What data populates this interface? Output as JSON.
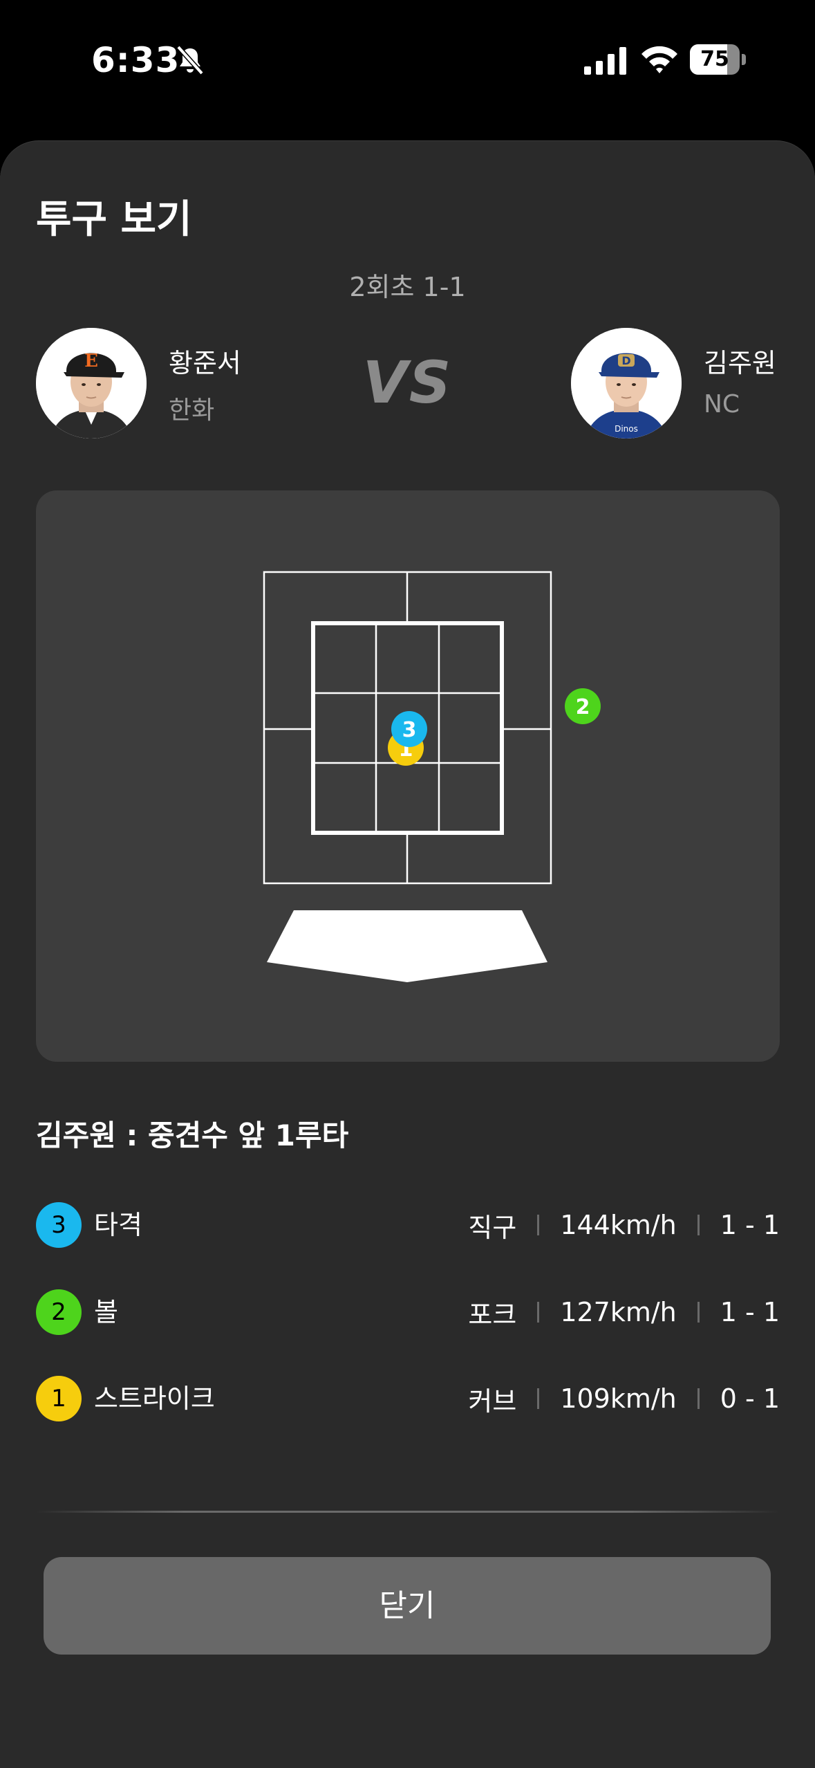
{
  "status_bar": {
    "time": "6:33",
    "battery_percent": "75",
    "battery_level": 0.75,
    "icons": [
      "bell-slash-icon",
      "cellular-signal-icon",
      "wifi-icon",
      "battery-icon"
    ]
  },
  "sheet": {
    "title": "투구 보기",
    "inning": "2회초 1-1",
    "vs_label": "VS",
    "pitcher": {
      "name": "황준서",
      "team": "한화"
    },
    "batter": {
      "name": "김주원",
      "team": "NC"
    },
    "result_text": "김주원 : 중견수 앞 1루타",
    "close_label": "닫기"
  },
  "pitches": [
    {
      "number": "3",
      "result": "타격",
      "type": "직구",
      "speed": "144km/h",
      "count": "1 - 1",
      "color": "#1ab8ee"
    },
    {
      "number": "2",
      "result": "볼",
      "type": "포크",
      "speed": "127km/h",
      "count": "1 - 1",
      "color": "#4ed41c"
    },
    {
      "number": "1",
      "result": "스트라이크",
      "type": "커브",
      "speed": "109km/h",
      "count": "0 - 1",
      "color": "#f6cd0d"
    }
  ],
  "colors": {
    "background": "#000000",
    "sheet": "#2a2a2a",
    "panel": "#3d3d3d",
    "button": "#686868",
    "hit": "#1ab8ee",
    "ball": "#4ed41c",
    "strike": "#f6cd0d"
  }
}
